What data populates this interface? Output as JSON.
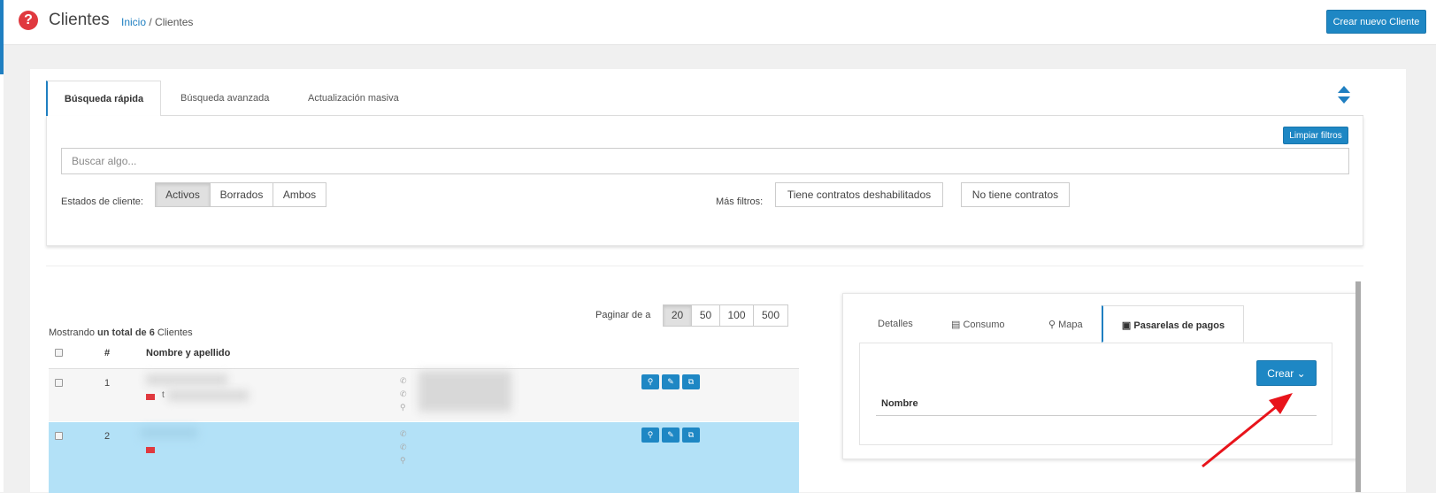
{
  "header": {
    "title": "Clientes",
    "breadcrumb_home": "Inicio",
    "breadcrumb_sep": "/",
    "breadcrumb_current": "Clientes",
    "create_button": "Crear nuevo Cliente"
  },
  "tabs": [
    "Búsqueda rápida",
    "Búsqueda avanzada",
    "Actualización masiva"
  ],
  "filters": {
    "clear_button": "Limpiar filtros",
    "search_placeholder": "Buscar algo...",
    "states_label": "Estados de cliente:",
    "states": [
      "Activos",
      "Borrados",
      "Ambos"
    ],
    "states_selected": "Activos",
    "more_label": "Más filtros:",
    "more": [
      "Tiene contratos deshabilitados",
      "No tiene contratos"
    ]
  },
  "table": {
    "showing_prefix": "Mostrando",
    "showing_bold": "un total de 6",
    "showing_suffix": "Clientes",
    "paginate_label": "Paginar de a",
    "page_sizes": [
      "20",
      "50",
      "100",
      "500"
    ],
    "page_size_selected": "20",
    "columns": [
      "#",
      "Nombre y apellido"
    ],
    "rows": [
      {
        "num": "1",
        "mail_char": "t"
      },
      {
        "num": "2",
        "mail_char": ""
      }
    ]
  },
  "detail": {
    "tabs": [
      "Detalles",
      "Consumo",
      "Mapa",
      "Pasarelas de pagos"
    ],
    "active_tab": "Pasarelas de pagos",
    "create_button": "Crear",
    "column": "Nombre"
  },
  "colors": {
    "primary": "#1e87c4",
    "danger": "#e0393f",
    "selected_row": "#b3e1f7",
    "annotation_arrow": "#e8141b"
  }
}
